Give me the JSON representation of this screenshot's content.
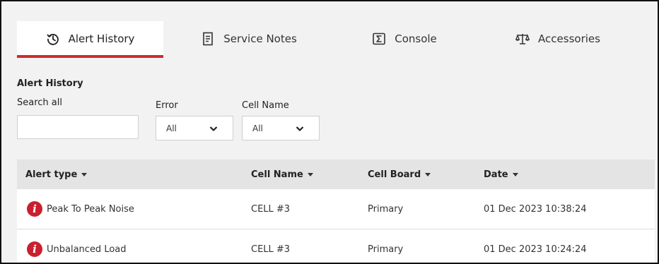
{
  "tabs": [
    {
      "label": "Alert History",
      "icon": "history-icon",
      "active": true
    },
    {
      "label": "Service Notes",
      "icon": "document-icon",
      "active": false
    },
    {
      "label": "Console",
      "icon": "console-icon",
      "active": false
    },
    {
      "label": "Accessories",
      "icon": "balance-scale-icon",
      "active": false
    }
  ],
  "accent_color": "#cc2b2b",
  "section": {
    "title": "Alert History"
  },
  "filters": {
    "search_label": "Search all",
    "search_value": "",
    "error_label": "Error",
    "error_value": "All",
    "cell_name_label": "Cell Name",
    "cell_name_value": "All"
  },
  "table": {
    "columns": [
      "Alert type",
      "Cell Name",
      "Cell Board",
      "Date"
    ],
    "rows": [
      {
        "alert_type": "Peak To Peak Noise",
        "cell_name": "CELL #3",
        "cell_board": "Primary",
        "date": "01 Dec 2023 10:38:24"
      },
      {
        "alert_type": "Unbalanced Load",
        "cell_name": "CELL #3",
        "cell_board": "Primary",
        "date": "01 Dec 2023 10:24:24"
      }
    ]
  }
}
